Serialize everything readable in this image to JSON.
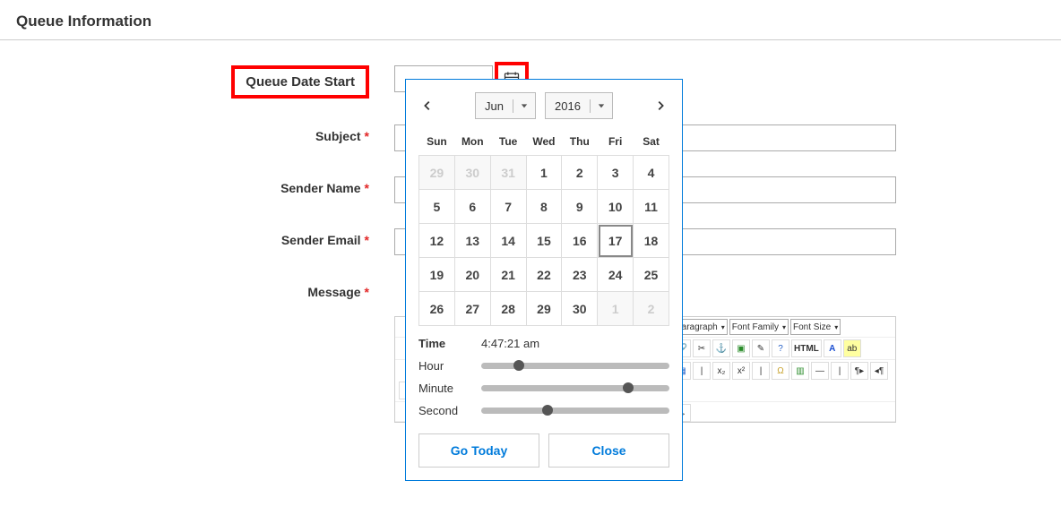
{
  "page_title": "Queue Information",
  "labels": {
    "queue_date_start": "Queue Date Start",
    "subject": "Subject",
    "sender_name": "Sender Name",
    "sender_email": "Sender Email",
    "message": "Message"
  },
  "datepicker": {
    "month": "Jun",
    "year": "2016",
    "dow": [
      "Sun",
      "Mon",
      "Tue",
      "Wed",
      "Thu",
      "Fri",
      "Sat"
    ],
    "weeks": [
      [
        {
          "d": "29",
          "other": true
        },
        {
          "d": "30",
          "other": true
        },
        {
          "d": "31",
          "other": true
        },
        {
          "d": "1"
        },
        {
          "d": "2"
        },
        {
          "d": "3"
        },
        {
          "d": "4"
        }
      ],
      [
        {
          "d": "5"
        },
        {
          "d": "6"
        },
        {
          "d": "7"
        },
        {
          "d": "8"
        },
        {
          "d": "9"
        },
        {
          "d": "10"
        },
        {
          "d": "11"
        }
      ],
      [
        {
          "d": "12"
        },
        {
          "d": "13"
        },
        {
          "d": "14"
        },
        {
          "d": "15"
        },
        {
          "d": "16"
        },
        {
          "d": "17",
          "sel": true
        },
        {
          "d": "18"
        }
      ],
      [
        {
          "d": "19"
        },
        {
          "d": "20"
        },
        {
          "d": "21"
        },
        {
          "d": "22"
        },
        {
          "d": "23"
        },
        {
          "d": "24"
        },
        {
          "d": "25"
        }
      ],
      [
        {
          "d": "26"
        },
        {
          "d": "27"
        },
        {
          "d": "28"
        },
        {
          "d": "29"
        },
        {
          "d": "30"
        },
        {
          "d": "1",
          "other": true
        },
        {
          "d": "2",
          "other": true
        }
      ]
    ],
    "time_label": "Time",
    "time_value": "4:47:21 am",
    "hour_label": "Hour",
    "minute_label": "Minute",
    "second_label": "Second",
    "hour_pct": 20,
    "minute_pct": 78,
    "second_pct": 35,
    "go_today": "Go Today",
    "close": "Close"
  },
  "editor": {
    "paragraph": "Paragraph",
    "font_family": "Font Family",
    "font_size": "Font Size",
    "html_btn": "HTML"
  }
}
